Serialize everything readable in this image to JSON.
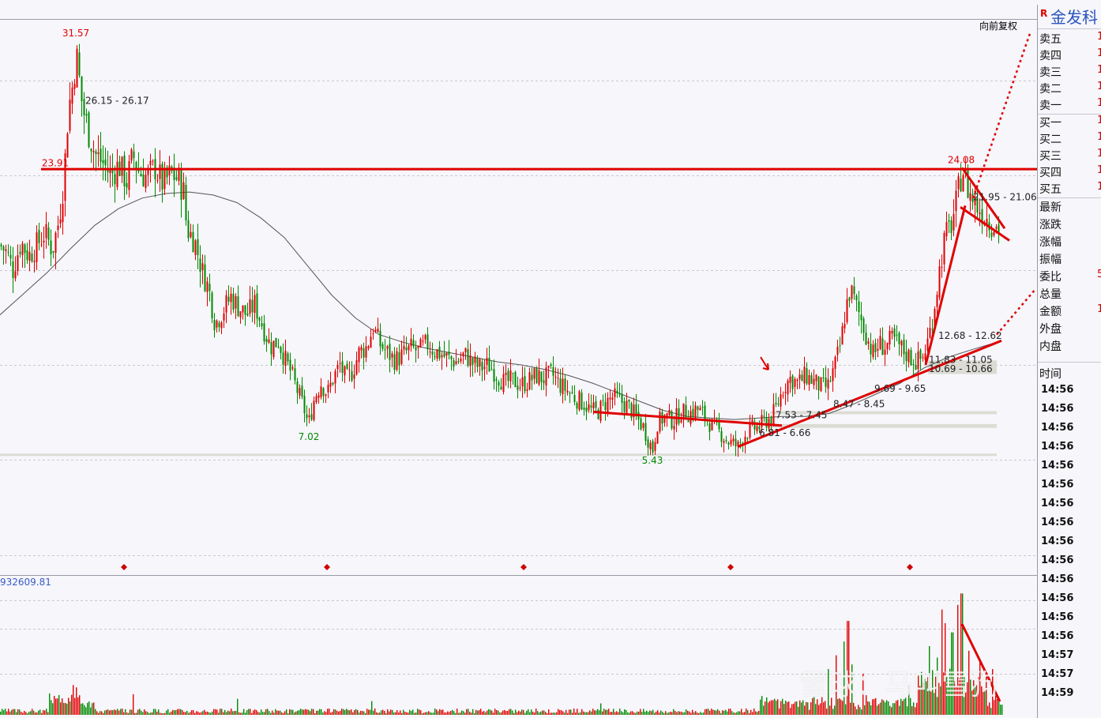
{
  "adjust_label": "向前复权",
  "volume_label": "932609.81",
  "watermark": "雪球：马叫雪狗",
  "side": {
    "flag": "R",
    "name": "金发科",
    "quote_rows": [
      "卖五",
      "卖四",
      "卖三",
      "卖二",
      "卖一",
      "买一",
      "买二",
      "买三",
      "买四",
      "买五"
    ],
    "info_rows": [
      "最新",
      "涨跌",
      "涨幅",
      "振幅",
      "委比",
      "总量",
      "金额",
      "外盘",
      "内盘"
    ],
    "info_peek": {
      "委比": "5",
      "金额": "1"
    },
    "time_header": "时间",
    "times": [
      "14:56",
      "14:56",
      "14:56",
      "14:56",
      "14:56",
      "14:56",
      "14:56",
      "14:56",
      "14:56",
      "14:56",
      "14:56",
      "14:56",
      "14:56",
      "14:56",
      "14:57",
      "14:57",
      "14:59"
    ]
  },
  "colors": {
    "up": "#e00000",
    "down": "#008a00",
    "trend": "#e00000",
    "ma": "#555555",
    "grid": "#c8c8d0"
  },
  "chart_data": {
    "type": "candlestick",
    "ylim": [
      3.5,
      33.6
    ],
    "path": [
      [
        0,
        18.9
      ],
      [
        8,
        18.4
      ],
      [
        16,
        17.3
      ],
      [
        26,
        19.1
      ],
      [
        36,
        18.2
      ],
      [
        46,
        18.9
      ],
      [
        56,
        19.7
      ],
      [
        66,
        18.6
      ],
      [
        74,
        20.5
      ],
      [
        80,
        23.0
      ],
      [
        86,
        27.8
      ],
      [
        92,
        29.6
      ],
      [
        96,
        31.57
      ],
      [
        104,
        28.0
      ],
      [
        112,
        26.3
      ],
      [
        120,
        24.9
      ],
      [
        130,
        24.3
      ],
      [
        140,
        23.5
      ],
      [
        150,
        24.2
      ],
      [
        160,
        23.1
      ],
      [
        168,
        24.8
      ],
      [
        176,
        23.7
      ],
      [
        186,
        23.4
      ],
      [
        196,
        24.0
      ],
      [
        206,
        22.9
      ],
      [
        216,
        23.6
      ],
      [
        226,
        23.2
      ],
      [
        232,
        22.4
      ],
      [
        236,
        20.0
      ],
      [
        246,
        19.2
      ],
      [
        256,
        17.1
      ],
      [
        264,
        16.0
      ],
      [
        272,
        13.7
      ],
      [
        282,
        14.6
      ],
      [
        292,
        15.5
      ],
      [
        302,
        14.8
      ],
      [
        312,
        14.3
      ],
      [
        322,
        15.0
      ],
      [
        332,
        13.6
      ],
      [
        342,
        12.2
      ],
      [
        352,
        12.6
      ],
      [
        360,
        11.4
      ],
      [
        368,
        10.5
      ],
      [
        376,
        9.3
      ],
      [
        384,
        8.2
      ],
      [
        390,
        7.02
      ],
      [
        398,
        8.9
      ],
      [
        406,
        9.8
      ],
      [
        414,
        9.1
      ],
      [
        422,
        10.2
      ],
      [
        430,
        11.0
      ],
      [
        438,
        10.0
      ],
      [
        446,
        10.6
      ],
      [
        454,
        11.8
      ],
      [
        464,
        12.2
      ],
      [
        472,
        13.5
      ],
      [
        480,
        12.4
      ],
      [
        490,
        11.8
      ],
      [
        500,
        11.3
      ],
      [
        510,
        11.7
      ],
      [
        520,
        12.1
      ],
      [
        530,
        11.9
      ],
      [
        540,
        12.4
      ],
      [
        548,
        12.0
      ],
      [
        558,
        11.7
      ],
      [
        568,
        11.4
      ],
      [
        578,
        11.2
      ],
      [
        588,
        11.7
      ],
      [
        598,
        11.1
      ],
      [
        608,
        10.8
      ],
      [
        618,
        11.0
      ],
      [
        628,
        10.4
      ],
      [
        638,
        9.8
      ],
      [
        648,
        10.0
      ],
      [
        658,
        9.7
      ],
      [
        668,
        9.9
      ],
      [
        678,
        10.3
      ],
      [
        688,
        10.1
      ],
      [
        698,
        10.4
      ],
      [
        708,
        9.7
      ],
      [
        718,
        9.3
      ],
      [
        728,
        8.8
      ],
      [
        738,
        8.5
      ],
      [
        748,
        8.0
      ],
      [
        756,
        7.9
      ],
      [
        766,
        8.5
      ],
      [
        776,
        8.9
      ],
      [
        786,
        8.6
      ],
      [
        796,
        8.2
      ],
      [
        806,
        7.5
      ],
      [
        814,
        6.9
      ],
      [
        820,
        6.1
      ],
      [
        826,
        5.43
      ],
      [
        832,
        7.2
      ],
      [
        842,
        7.6
      ],
      [
        852,
        7.3
      ],
      [
        862,
        7.9
      ],
      [
        872,
        7.8
      ],
      [
        882,
        8.1
      ],
      [
        892,
        7.6
      ],
      [
        902,
        6.9
      ],
      [
        912,
        6.5
      ],
      [
        920,
        6.0
      ],
      [
        928,
        5.8
      ],
      [
        934,
        5.6
      ],
      [
        942,
        6.4
      ],
      [
        952,
        6.81
      ],
      [
        960,
        6.9
      ],
      [
        968,
        7.3
      ],
      [
        976,
        7.5
      ],
      [
        984,
        8.4
      ],
      [
        992,
        9.6
      ],
      [
        1000,
        10.1
      ],
      [
        1010,
        9.8
      ],
      [
        1020,
        10.3
      ],
      [
        1030,
        9.9
      ],
      [
        1040,
        9.5
      ],
      [
        1048,
        9.6
      ],
      [
        1056,
        10.8
      ],
      [
        1064,
        12.4
      ],
      [
        1070,
        14.6
      ],
      [
        1076,
        16.0
      ],
      [
        1084,
        14.8
      ],
      [
        1092,
        13.7
      ],
      [
        1100,
        12.4
      ],
      [
        1106,
        11.6
      ],
      [
        1112,
        12.4
      ],
      [
        1120,
        12.2
      ],
      [
        1130,
        12.7
      ],
      [
        1140,
        12.1
      ],
      [
        1150,
        11.6
      ],
      [
        1160,
        11.2
      ],
      [
        1168,
        11.5
      ],
      [
        1176,
        12.9
      ],
      [
        1184,
        15.4
      ],
      [
        1190,
        17.6
      ],
      [
        1196,
        19.4
      ],
      [
        1204,
        20.3
      ],
      [
        1210,
        21.6
      ],
      [
        1216,
        23.4
      ],
      [
        1218,
        24.08
      ],
      [
        1226,
        22.4
      ],
      [
        1236,
        21.5
      ],
      [
        1246,
        20.9
      ],
      [
        1256,
        20.3
      ],
      [
        1266,
        19.9
      ]
    ],
    "ma": [
      [
        0,
        14.3
      ],
      [
        30,
        15.7
      ],
      [
        60,
        17.1
      ],
      [
        90,
        18.7
      ],
      [
        120,
        20.2
      ],
      [
        150,
        21.3
      ],
      [
        180,
        22.0
      ],
      [
        210,
        22.3
      ],
      [
        240,
        22.4
      ],
      [
        270,
        22.2
      ],
      [
        300,
        21.7
      ],
      [
        330,
        20.7
      ],
      [
        360,
        19.4
      ],
      [
        390,
        17.5
      ],
      [
        420,
        15.6
      ],
      [
        450,
        14.1
      ],
      [
        480,
        13.0
      ],
      [
        510,
        12.5
      ],
      [
        540,
        12.1
      ],
      [
        570,
        11.8
      ],
      [
        600,
        11.5
      ],
      [
        630,
        11.2
      ],
      [
        660,
        11.0
      ],
      [
        690,
        10.7
      ],
      [
        720,
        10.3
      ],
      [
        750,
        9.8
      ],
      [
        780,
        9.2
      ],
      [
        810,
        8.6
      ],
      [
        840,
        8.0
      ],
      [
        870,
        7.6
      ],
      [
        900,
        7.5
      ],
      [
        930,
        7.4
      ],
      [
        960,
        7.5
      ],
      [
        990,
        7.6
      ],
      [
        1020,
        7.6
      ],
      [
        1050,
        7.8
      ],
      [
        1080,
        8.4
      ],
      [
        1110,
        9.1
      ],
      [
        1140,
        9.8
      ],
      [
        1170,
        10.8
      ],
      [
        1200,
        11.5
      ],
      [
        1230,
        12.0
      ],
      [
        1256,
        12.4
      ]
    ],
    "labels": [
      {
        "x": 96,
        "price": 32.65,
        "text": "31.57",
        "color": "up"
      },
      {
        "x": 108,
        "price": 28.2,
        "text": "26.15 - 26.17",
        "color": "ink",
        "anchor": "start"
      },
      {
        "x": 70,
        "price": 24.1,
        "text": "23.91",
        "color": "up"
      },
      {
        "x": 391,
        "price": 6.05,
        "text": "7.02",
        "color": "down"
      },
      {
        "x": 826,
        "price": 4.48,
        "text": "5.43",
        "color": "down"
      },
      {
        "x": 1217,
        "price": 24.3,
        "text": "24.08",
        "color": "up"
      },
      {
        "x": 1232,
        "price": 21.85,
        "text": "21.95 - 21.06",
        "color": "ink",
        "anchor": "start"
      },
      {
        "x": 1188,
        "price": 12.73,
        "text": "12.68 - 12.62",
        "color": "ink",
        "anchor": "start"
      },
      {
        "x": 1176,
        "price": 11.13,
        "text": "11.83 - 11.05",
        "color": "ink",
        "anchor": "start"
      },
      {
        "x": 1176,
        "price": 10.53,
        "text": "10.69 - 10.66",
        "color": "ink",
        "anchor": "start"
      },
      {
        "x": 1107,
        "price": 9.23,
        "text": "9.69 - 9.65",
        "color": "ink",
        "anchor": "start"
      },
      {
        "x": 1055,
        "price": 8.2,
        "text": "8.47 - 8.45",
        "color": "ink",
        "anchor": "start"
      },
      {
        "x": 982,
        "price": 7.48,
        "text": "7.53 - 7.45",
        "color": "ink",
        "anchor": "start"
      },
      {
        "x": 961,
        "price": 6.32,
        "text": "6.81 - 6.66",
        "color": "ink",
        "anchor": "start"
      }
    ],
    "resistance": {
      "price": 23.91,
      "x": [
        52,
        1313
      ]
    },
    "trendlines": [
      [
        [
          752,
          7.9
        ],
        [
          990,
          7.0
        ]
      ],
      [
        [
          934,
          5.6
        ],
        [
          1268,
          12.6
        ]
      ],
      [
        [
          1172,
          11.0
        ],
        [
          1222,
          21.5
        ]
      ],
      [
        [
          1216,
          21.4
        ],
        [
          1278,
          19.2
        ]
      ],
      [
        [
          1218,
          24.0
        ],
        [
          1272,
          20.0
        ]
      ]
    ],
    "dotted": [
      [
        [
          1232,
          22.0
        ],
        [
          1305,
          33.0
        ]
      ],
      [
        [
          1262,
          13.0
        ],
        [
          1311,
          16.0
        ]
      ]
    ],
    "levels": [
      {
        "y0": 10.4,
        "y1": 11.3,
        "x0": 1175,
        "x1": 1262
      },
      {
        "y0": 7.75,
        "y1": 7.95,
        "x0": 975,
        "x1": 1262
      },
      {
        "y0": 6.85,
        "y1": 7.1,
        "x0": 975,
        "x1": 1262
      },
      {
        "y0": 5.0,
        "y1": 5.15,
        "x0": 0,
        "x1": 1262
      }
    ],
    "markers_x": [
      157,
      414,
      663,
      925,
      1152
    ],
    "volume_spikes": [
      [
        92,
        13
      ],
      [
        96,
        12
      ],
      [
        168,
        9
      ],
      [
        300,
        7
      ],
      [
        470,
        6
      ],
      [
        760,
        5
      ],
      [
        990,
        7
      ],
      [
        1018,
        4
      ],
      [
        1048,
        20
      ],
      [
        1058,
        26
      ],
      [
        1068,
        32
      ],
      [
        1073,
        41
      ],
      [
        1078,
        22
      ],
      [
        1092,
        18
      ],
      [
        1150,
        13
      ],
      [
        1176,
        30
      ],
      [
        1186,
        25
      ],
      [
        1192,
        46
      ],
      [
        1196,
        40
      ],
      [
        1205,
        36
      ],
      [
        1212,
        48
      ],
      [
        1217,
        53
      ],
      [
        1226,
        28
      ],
      [
        1240,
        24
      ],
      [
        1256,
        20
      ]
    ]
  }
}
